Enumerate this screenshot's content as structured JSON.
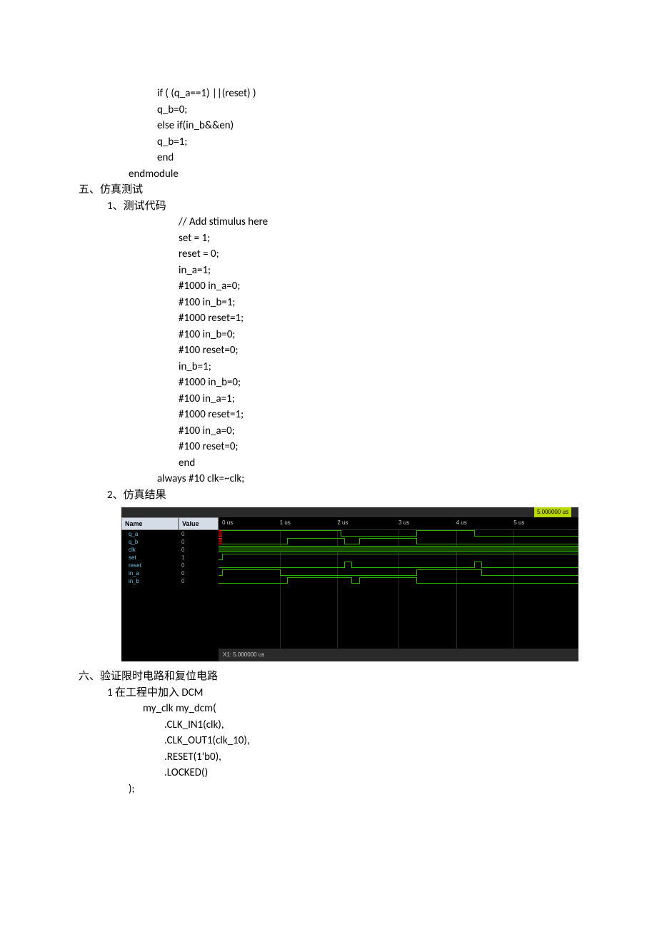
{
  "top_code": [
    "if ( (q_a==1) ||(reset) )",
    "q_b=0;",
    "else if(in_b&&en)",
    "q_b=1;",
    "end"
  ],
  "endmodule": "endmodule",
  "section5_title": "五、仿真测试",
  "section5_sub1": "1、测试代码",
  "test_code": [
    "// Add stimulus here",
    "set = 1;",
    "reset = 0;",
    "in_a=1;",
    "#1000 in_a=0;",
    "#100 in_b=1;",
    "#1000 reset=1;",
    "#100 in_b=0;",
    "#100 reset=0;",
    "in_b=1;",
    "#1000 in_b=0;",
    "#100 in_a=1;",
    "#1000 reset=1;",
    "#100 in_a=0;",
    "#100 reset=0;",
    "end"
  ],
  "always_line": "always #10 clk=~clk;",
  "section5_sub2": "2、仿真结果",
  "section6_title": "六、验证限时电路和复位电路",
  "section6_sub1": "1 在工程中加入 DCM",
  "dcm_code": [
    "my_clk my_dcm(",
    ".CLK_IN1(clk),",
    ".CLK_OUT1(clk_10),",
    ".RESET(1'b0),",
    ".LOCKED()"
  ],
  "dcm_close": ");",
  "wave": {
    "time_badge": "5.000000 us",
    "name_header": "Name",
    "value_header": "Value",
    "bottom_label": "X1: 5.000000 us",
    "ticks": [
      "0 us",
      "1 us",
      "2 us",
      "3 us",
      "4 us",
      "5 us"
    ],
    "signals": [
      {
        "name": "q_a",
        "value": "0"
      },
      {
        "name": "q_b",
        "value": "0"
      },
      {
        "name": "clk",
        "value": "0"
      },
      {
        "name": "set",
        "value": "1"
      },
      {
        "name": "reset",
        "value": "0"
      },
      {
        "name": "in_a",
        "value": "0"
      },
      {
        "name": "in_b",
        "value": "0"
      }
    ]
  },
  "chart_data": {
    "type": "digital-waveform",
    "time_range_us": [
      0,
      5
    ],
    "signals": {
      "q_a": [
        {
          "t": 0,
          "v": "x"
        },
        {
          "t": 0.03,
          "v": 1
        },
        {
          "t": 2.03,
          "v": 0
        },
        {
          "t": 3.3,
          "v": 1
        },
        {
          "t": 4.3,
          "v": 0
        }
      ],
      "q_b": [
        {
          "t": 0,
          "v": "x"
        },
        {
          "t": 0.03,
          "v": 0
        },
        {
          "t": 1.13,
          "v": 1
        },
        {
          "t": 2.1,
          "v": 0
        },
        {
          "t": 2.33,
          "v": 1
        },
        {
          "t": 3.33,
          "v": 0
        }
      ],
      "clk": [
        {
          "type": "clock",
          "period_ns": 20
        }
      ],
      "set": [
        {
          "t": 0,
          "v": 1
        }
      ],
      "reset": [
        {
          "t": 0,
          "v": 0
        },
        {
          "t": 2.1,
          "v": 1
        },
        {
          "t": 2.2,
          "v": 0
        },
        {
          "t": 4.3,
          "v": 1
        },
        {
          "t": 4.4,
          "v": 0
        }
      ],
      "in_a": [
        {
          "t": 0,
          "v": 1
        },
        {
          "t": 1.0,
          "v": 0
        },
        {
          "t": 3.3,
          "v": 1
        },
        {
          "t": 4.4,
          "v": 0
        }
      ],
      "in_b": [
        {
          "t": 0,
          "v": 0
        },
        {
          "t": 1.1,
          "v": 1
        },
        {
          "t": 2.2,
          "v": 0
        },
        {
          "t": 2.3,
          "v": 1
        },
        {
          "t": 3.3,
          "v": 0
        }
      ]
    }
  }
}
